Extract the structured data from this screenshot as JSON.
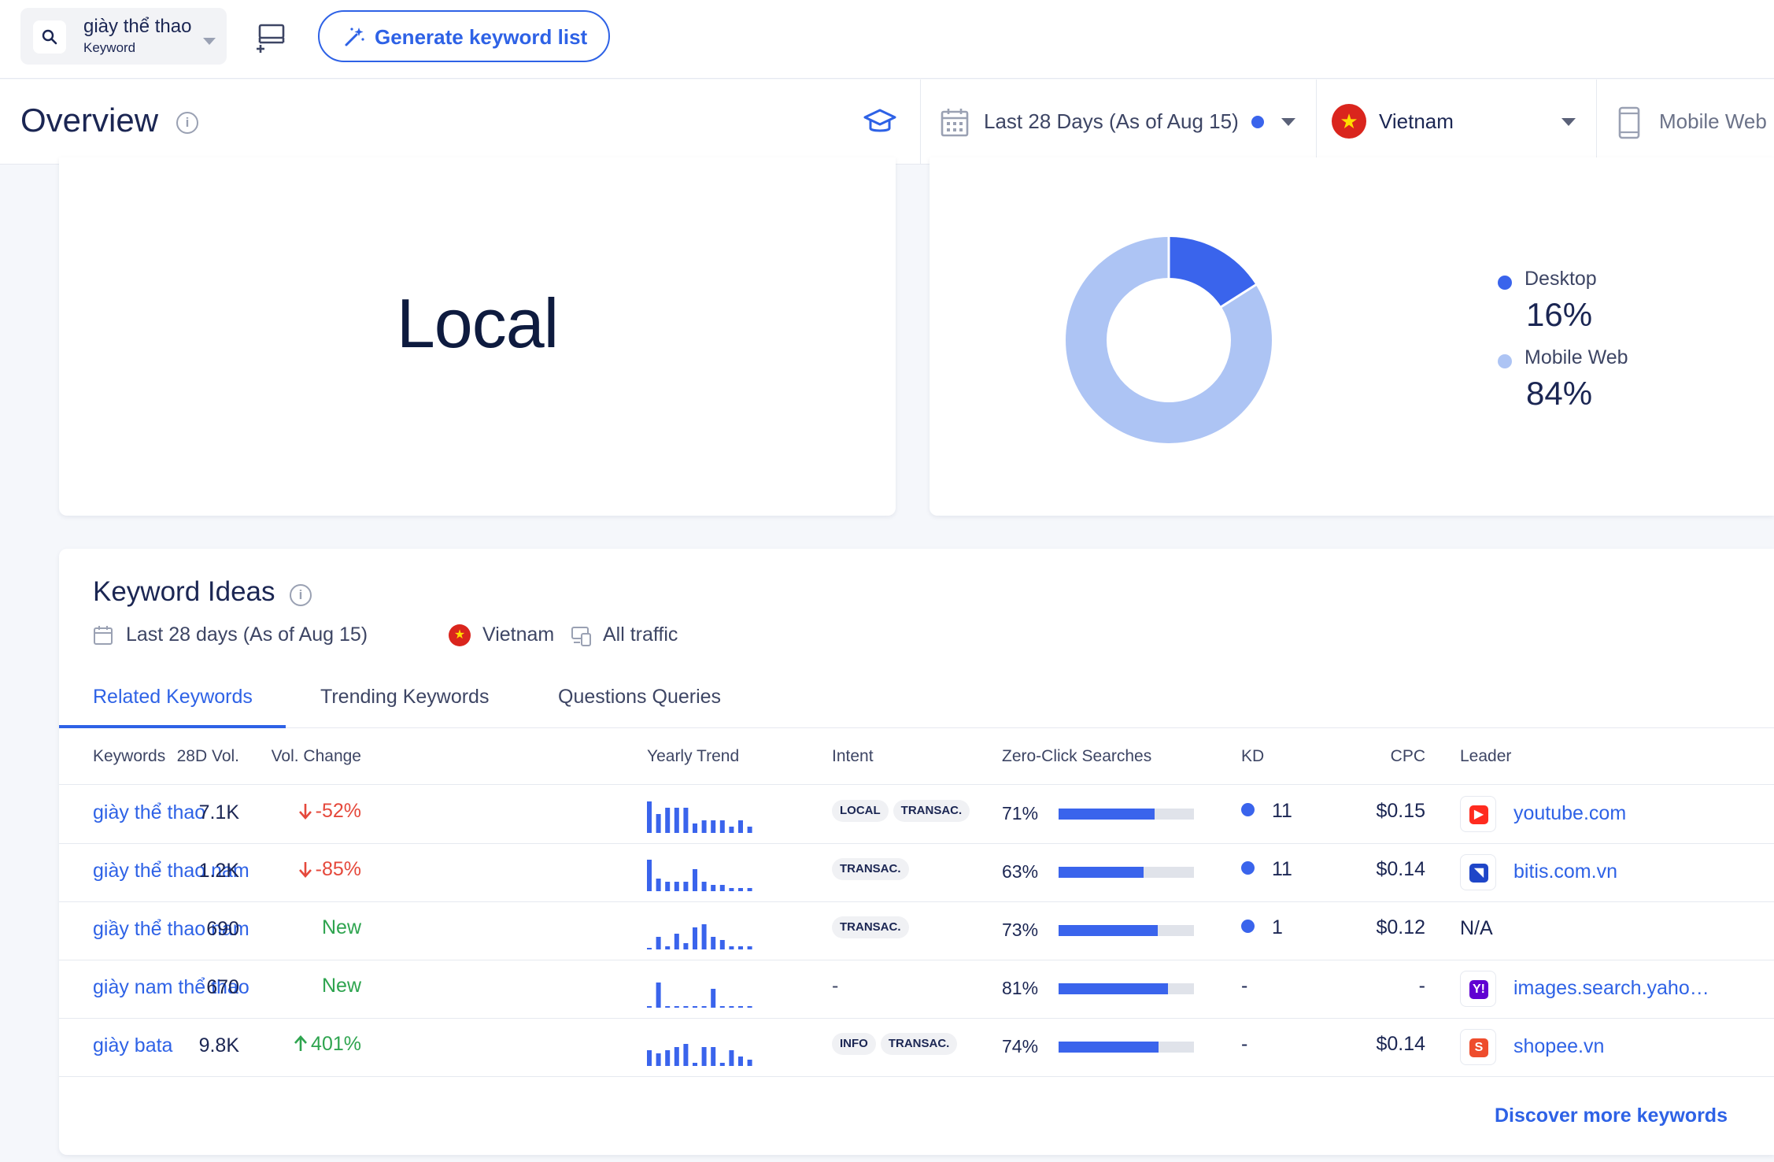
{
  "topbar": {
    "keyword": "giày thể thao",
    "keyword_type": "Keyword",
    "generate_label": "Generate keyword list"
  },
  "overview": {
    "title": "Overview",
    "date_range": "Last 28 Days (As of Aug 15)",
    "country": "Vietnam",
    "device": "Mobile Web"
  },
  "intent_card": {
    "value": "Local"
  },
  "device_card": {
    "items": [
      {
        "label": "Desktop",
        "pct": "16%",
        "share": 16,
        "color": "#3a64ec"
      },
      {
        "label": "Mobile Web",
        "pct": "84%",
        "share": 84,
        "color": "#adc4f4"
      }
    ]
  },
  "ideas": {
    "title": "Keyword Ideas",
    "date": "Last 28 days (As of Aug 15)",
    "country": "Vietnam",
    "traffic": "All traffic",
    "tabs": [
      "Related Keywords",
      "Trending Keywords",
      "Questions Queries"
    ],
    "columns": {
      "keywords": "Keywords",
      "vol": "28D Vol.",
      "change": "Vol. Change",
      "trend": "Yearly Trend",
      "intent": "Intent",
      "zero_click": "Zero-Click Searches",
      "kd": "KD",
      "cpc": "CPC",
      "leader": "Leader"
    },
    "rows": [
      {
        "keyword": "giày thể thao",
        "vol": "7.1K",
        "change": "-52%",
        "change_dir": "down",
        "trend": [
          10,
          6,
          8,
          8,
          8,
          3,
          4,
          4,
          4,
          2,
          4,
          2
        ],
        "intents": [
          "LOCAL",
          "TRANSAC."
        ],
        "zero_click": "71%",
        "zero_click_share": 71,
        "kd": "11",
        "cpc": "$0.15",
        "leader": "youtube.com",
        "leader_icon": "youtube-icon",
        "leader_color": "#ff2b1f",
        "leader_glyph": "▶"
      },
      {
        "keyword": "giày thể thao nam",
        "vol": "1.2K",
        "change": "-85%",
        "change_dir": "down",
        "trend": [
          10,
          4,
          3,
          3,
          3,
          7,
          3,
          2,
          2,
          1,
          1,
          1
        ],
        "intents": [
          "TRANSAC."
        ],
        "zero_click": "63%",
        "zero_click_share": 63,
        "kd": "11",
        "cpc": "$0.14",
        "leader": "bitis.com.vn",
        "leader_icon": "bitis-icon",
        "leader_color": "#1f46c8",
        "leader_glyph": "◥"
      },
      {
        "keyword": "giầy thể thao nam",
        "vol": "690",
        "change": "New",
        "change_dir": "new",
        "trend": [
          0,
          4,
          1,
          5,
          2,
          7,
          8,
          4,
          3,
          1,
          1,
          1
        ],
        "intents": [
          "TRANSAC."
        ],
        "zero_click": "73%",
        "zero_click_share": 73,
        "kd": "1",
        "cpc": "$0.12",
        "leader": "N/A",
        "leader_icon": "",
        "leader_color": "",
        "leader_glyph": ""
      },
      {
        "keyword": "giày nam thể thao",
        "vol": "670",
        "change": "New",
        "change_dir": "new",
        "trend": [
          0,
          8,
          0,
          0,
          0,
          0,
          0,
          6,
          0,
          0,
          0,
          0
        ],
        "intents": [],
        "zero_click": "81%",
        "zero_click_share": 81,
        "kd": "-",
        "cpc": "-",
        "leader": "images.search.yaho…",
        "leader_icon": "yahoo-icon",
        "leader_color": "#6001d2",
        "leader_glyph": "Y!"
      },
      {
        "keyword": "giày bata",
        "vol": "9.8K",
        "change": "401%",
        "change_dir": "up",
        "trend": [
          5,
          4,
          5,
          6,
          7,
          1,
          6,
          6,
          1,
          5,
          3,
          2
        ],
        "intents": [
          "INFO",
          "TRANSAC."
        ],
        "zero_click": "74%",
        "zero_click_share": 74,
        "kd": "-",
        "cpc": "$0.14",
        "leader": "shopee.vn",
        "leader_icon": "shopee-icon",
        "leader_color": "#ee4d2d",
        "leader_glyph": "S"
      }
    ],
    "discover_label": "Discover more keywords"
  }
}
